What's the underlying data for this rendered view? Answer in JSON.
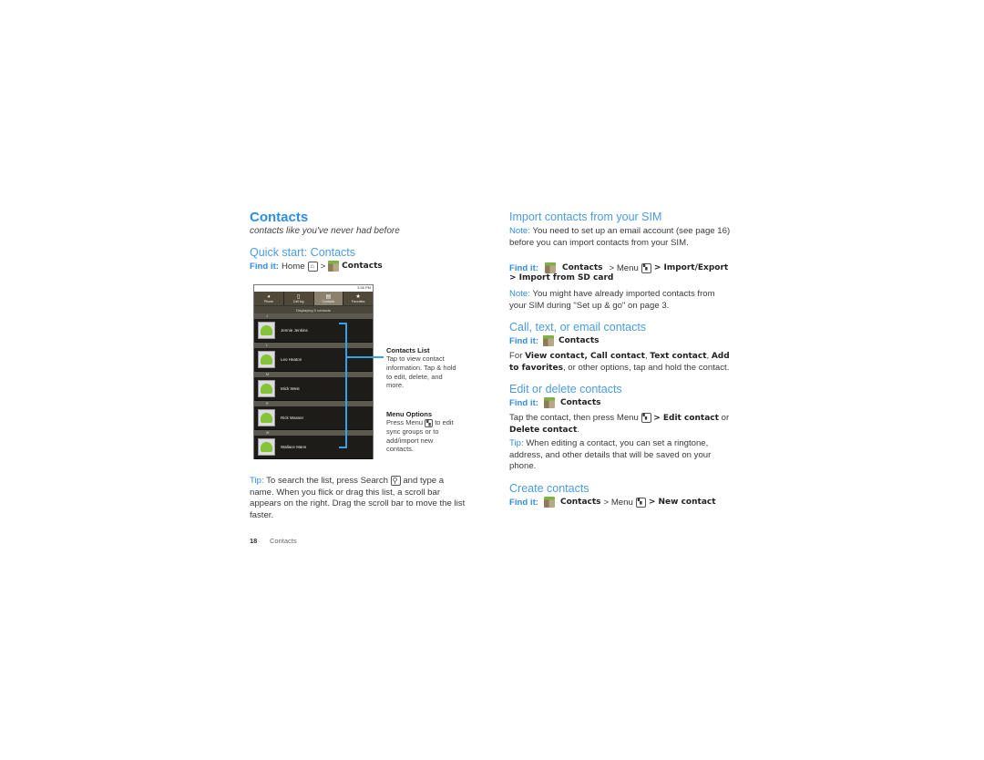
{
  "page": {
    "title": "Contacts",
    "subtitle": "contacts like you've never had before",
    "footer_page": "18",
    "footer_section": "Contacts"
  },
  "quick_start": {
    "heading": "Quick start: Contacts",
    "find_label": "Find it:",
    "home": "Home",
    "sep": ">",
    "contacts": "Contacts"
  },
  "phone": {
    "time": "3:36 PM",
    "tabs": [
      {
        "label": "Phone",
        "icon": "phone-icon"
      },
      {
        "label": "Call log",
        "icon": "call-log-icon"
      },
      {
        "label": "Contacts",
        "icon": "contacts-icon"
      },
      {
        "label": "Favorites",
        "icon": "star-icon"
      }
    ],
    "display_text": "Displaying 5 contacts",
    "sections": [
      {
        "letter": "J",
        "name": "Jennie Jenkins"
      },
      {
        "letter": "L",
        "name": "Leo Heaton"
      },
      {
        "letter": "M",
        "name": "Mick West"
      },
      {
        "letter": "R",
        "name": "Rick Wasser"
      },
      {
        "letter": "W",
        "name": "Wallace Mans"
      }
    ]
  },
  "callouts": {
    "list_title": "Contacts  List",
    "list_text": "Tap to view contact information. Tap & hold to edit, delete, and more.",
    "menu_title": "Menu Options",
    "menu_text_1": "Press Menu",
    "menu_text_2": "to edit sync groups or to add/import new contacts."
  },
  "tip_left": {
    "label": "Tip:",
    "text_1": "To search the list, press Search",
    "text_2": "and type a name. When you flick or drag this list, a scroll bar appears on the right. Drag the scroll bar to move the list faster."
  },
  "import": {
    "heading": "Import contacts from your SIM",
    "note1_label": "Note:",
    "note1_text": "You need to set up an email account (see page 16) before you can import contacts from your SIM.",
    "find_label": "Find it:",
    "contacts": "Contacts",
    "menu": "> Menu",
    "import_export": "> Import/Export",
    "import_sd": "> Import from SD card",
    "note2_label": "Note:",
    "note2_text": "You might have already imported contacts from your SIM during \"Set up & go\" on page 3."
  },
  "call": {
    "heading": "Call, text, or email contacts",
    "find_label": "Find it:",
    "contacts": "Contacts",
    "text_for": "For",
    "opt1": "View contact, Call contact",
    "opt2": "Text contact",
    "opt3": "Add to favorites",
    "text_end": ", or other options, tap and hold the contact."
  },
  "edit": {
    "heading": "Edit or delete contacts",
    "find_label": "Find it:",
    "contacts": "Contacts",
    "text_1": "Tap the contact, then press Menu",
    "edit_contact": "> Edit contact",
    "or": "or",
    "delete_contact": "Delete contact",
    "period": "."
  },
  "tip_right": {
    "label": "Tip:",
    "text": "When editing a contact, you can set a ringtone, address, and other details that will be saved on your phone."
  },
  "create": {
    "heading": "Create contacts",
    "find_label": "Find it:",
    "contacts": "Contacts",
    "menu": "> Menu",
    "new_contact": "> New contact"
  }
}
